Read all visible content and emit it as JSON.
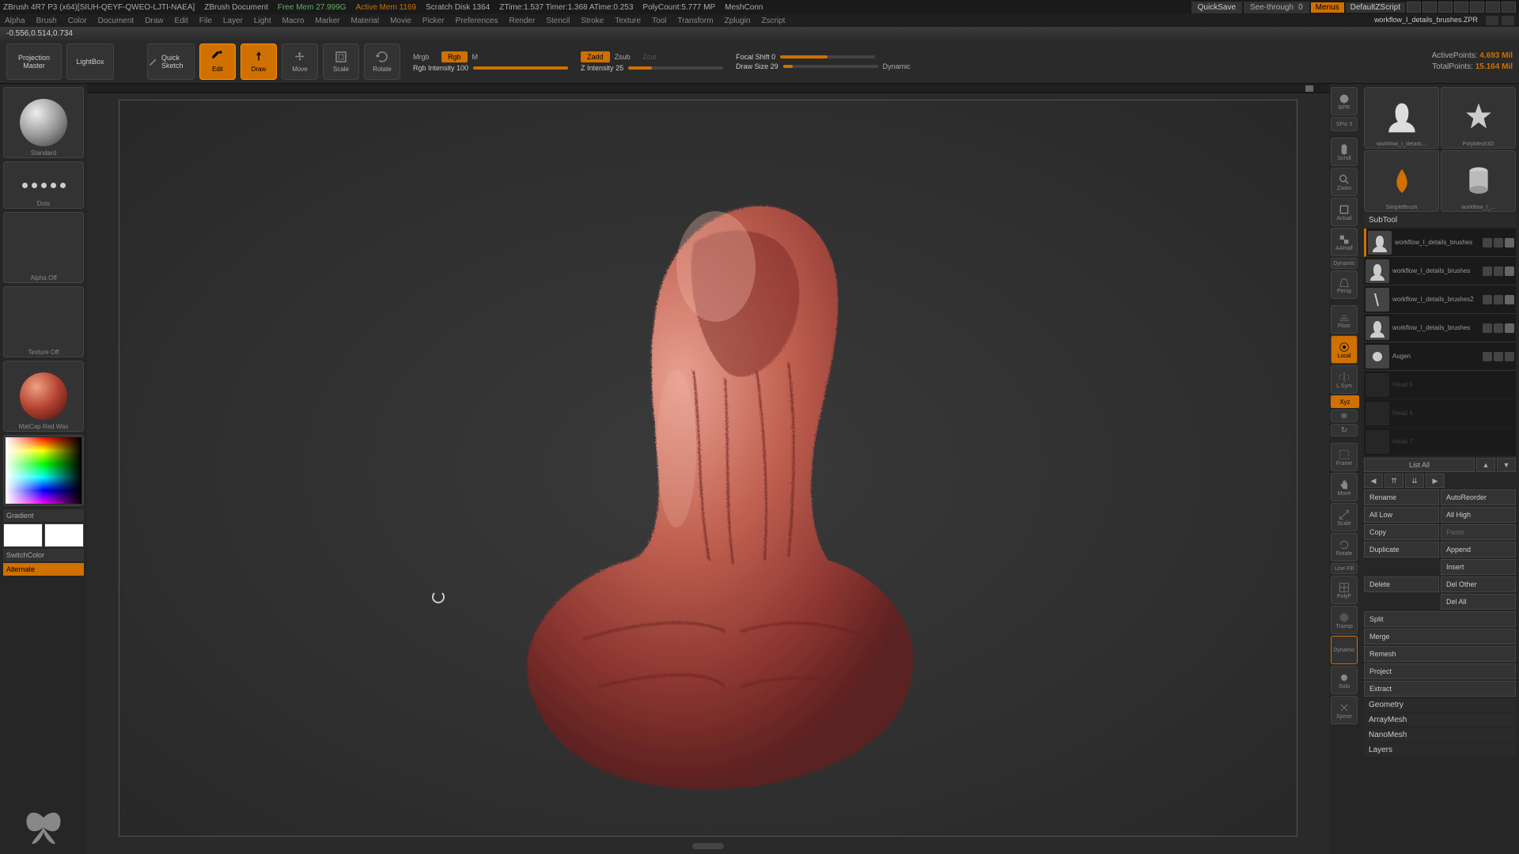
{
  "titlebar": {
    "app": "ZBrush 4R7 P3 (x64)[SIUH-QEYF-QWEO-LJTI-NAEA]",
    "doc": "ZBrush Document",
    "free_mem": "Free Mem 27.999G",
    "active_mem": "Active Mem 1169",
    "scratch": "Scratch Disk 1364",
    "ztime": "ZTime:1.537 Timer:1.368 ATime:0.253",
    "polycount": "PolyCount:5.777 MP",
    "meshconn": "MeshConn",
    "quicksave": "QuickSave",
    "seethrough": "See-through",
    "seethrough_val": "0",
    "menus": "Menus",
    "script": "DefaultZScript"
  },
  "menubar": {
    "items": [
      "Alpha",
      "Brush",
      "Color",
      "Document",
      "Draw",
      "Edit",
      "File",
      "Layer",
      "Light",
      "Macro",
      "Marker",
      "Material",
      "Movie",
      "Picker",
      "Preferences",
      "Render",
      "Stencil",
      "Stroke",
      "Texture",
      "Tool",
      "Transform",
      "Zplugin",
      "Zscript"
    ]
  },
  "status": {
    "coords": "-0.556,0.514,0.734"
  },
  "shelf": {
    "proj_master": "Projection Master",
    "lightbox": "LightBox",
    "quicksketch": "Quick Sketch",
    "edit": "Edit",
    "draw": "Draw",
    "move": "Move",
    "scale": "Scale",
    "rotate": "Rotate",
    "mrgb": "Mrgb",
    "rgb": "Rgb",
    "m": "M",
    "rgb_intensity": "Rgb Intensity 100",
    "zadd": "Zadd",
    "zsub": "Zsub",
    "zcut": "Zcut",
    "z_intensity": "Z Intensity 25",
    "focal_shift": "Focal Shift 0",
    "draw_size": "Draw Size 29",
    "dynamic": "Dynamic",
    "active_pts_lbl": "ActivePoints:",
    "active_pts": "4.693 Mil",
    "total_pts_lbl": "TotalPoints:",
    "total_pts": "15.164 Mil"
  },
  "left": {
    "brush": "Standard",
    "stroke": "Dots",
    "alpha": "Alpha Off",
    "texture": "Texture Off",
    "material": "MatCap Red Wax",
    "gradient": "Gradient",
    "switchcolor": "SwitchColor",
    "alternate": "Alternate"
  },
  "right_icons": {
    "bpr": "BPR",
    "spix": "SPix 3",
    "scroll": "Scroll",
    "zoom": "Zoom",
    "actual": "Actual",
    "aahalf": "AAHalf",
    "dynamic": "Dynamic",
    "persp": "Persp",
    "floor": "Floor",
    "local": "Local",
    "lsym": "L.Sym",
    "xyz": "Xyz",
    "frame": "Frame",
    "move": "Move",
    "scale": "Scale",
    "rotate": "Rotate",
    "linefill": "Line Fill",
    "polyf": "PolyF",
    "transp": "Transp",
    "dynamic2": "Dynamic",
    "solo": "Solo",
    "xpose": "Xpose"
  },
  "right_panel": {
    "tool_name": "workflow_I_details_brushes.ZPR",
    "tiles": {
      "a": "workflow_I_details...",
      "b": "PolyMesh3D",
      "c": "SimpleBrush",
      "d": "workflow_I_..."
    },
    "subtool_hdr": "SubTool",
    "subtools": [
      {
        "name": "workflow_I_details_brushes",
        "active": true,
        "visible": true
      },
      {
        "name": "workflow_I_details_brushes",
        "active": false,
        "visible": true
      },
      {
        "name": "workflow_I_details_brushes2",
        "active": false,
        "visible": true
      },
      {
        "name": "workflow_I_details_brushes",
        "active": false,
        "visible": true
      },
      {
        "name": "Augen",
        "active": false,
        "visible": false
      }
    ],
    "list_all": "List All",
    "buttons": {
      "rename": "Rename",
      "autoreorder": "AutoReorder",
      "all_low": "All Low",
      "all_high": "All High",
      "copy": "Copy",
      "paste": "Paste",
      "duplicate": "Duplicate",
      "append": "Append",
      "insert": "Insert",
      "delete": "Delete",
      "del_other": "Del Other",
      "del_all": "Del All",
      "split": "Split",
      "merge": "Merge",
      "remesh": "Remesh",
      "project": "Project",
      "extract": "Extract"
    },
    "sections": [
      "Geometry",
      "ArrayMesh",
      "NanoMesh",
      "Layers"
    ]
  }
}
